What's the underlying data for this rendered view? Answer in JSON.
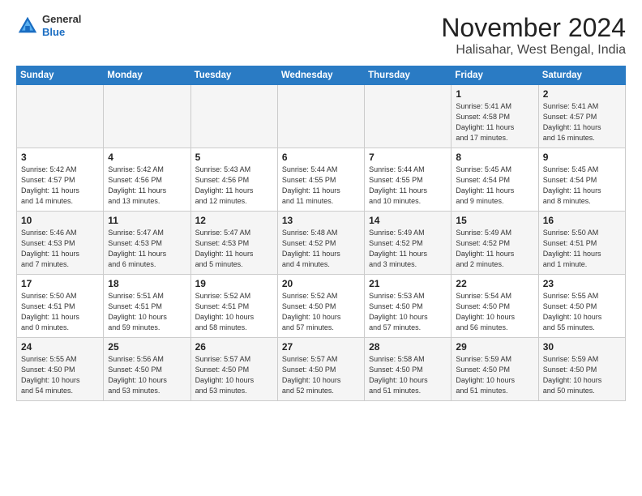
{
  "header": {
    "logo_line1": "General",
    "logo_line2": "Blue",
    "month_title": "November 2024",
    "location": "Halisahar, West Bengal, India"
  },
  "days_of_week": [
    "Sunday",
    "Monday",
    "Tuesday",
    "Wednesday",
    "Thursday",
    "Friday",
    "Saturday"
  ],
  "weeks": [
    [
      {
        "day": "",
        "info": ""
      },
      {
        "day": "",
        "info": ""
      },
      {
        "day": "",
        "info": ""
      },
      {
        "day": "",
        "info": ""
      },
      {
        "day": "",
        "info": ""
      },
      {
        "day": "1",
        "info": "Sunrise: 5:41 AM\nSunset: 4:58 PM\nDaylight: 11 hours\nand 17 minutes."
      },
      {
        "day": "2",
        "info": "Sunrise: 5:41 AM\nSunset: 4:57 PM\nDaylight: 11 hours\nand 16 minutes."
      }
    ],
    [
      {
        "day": "3",
        "info": "Sunrise: 5:42 AM\nSunset: 4:57 PM\nDaylight: 11 hours\nand 14 minutes."
      },
      {
        "day": "4",
        "info": "Sunrise: 5:42 AM\nSunset: 4:56 PM\nDaylight: 11 hours\nand 13 minutes."
      },
      {
        "day": "5",
        "info": "Sunrise: 5:43 AM\nSunset: 4:56 PM\nDaylight: 11 hours\nand 12 minutes."
      },
      {
        "day": "6",
        "info": "Sunrise: 5:44 AM\nSunset: 4:55 PM\nDaylight: 11 hours\nand 11 minutes."
      },
      {
        "day": "7",
        "info": "Sunrise: 5:44 AM\nSunset: 4:55 PM\nDaylight: 11 hours\nand 10 minutes."
      },
      {
        "day": "8",
        "info": "Sunrise: 5:45 AM\nSunset: 4:54 PM\nDaylight: 11 hours\nand 9 minutes."
      },
      {
        "day": "9",
        "info": "Sunrise: 5:45 AM\nSunset: 4:54 PM\nDaylight: 11 hours\nand 8 minutes."
      }
    ],
    [
      {
        "day": "10",
        "info": "Sunrise: 5:46 AM\nSunset: 4:53 PM\nDaylight: 11 hours\nand 7 minutes."
      },
      {
        "day": "11",
        "info": "Sunrise: 5:47 AM\nSunset: 4:53 PM\nDaylight: 11 hours\nand 6 minutes."
      },
      {
        "day": "12",
        "info": "Sunrise: 5:47 AM\nSunset: 4:53 PM\nDaylight: 11 hours\nand 5 minutes."
      },
      {
        "day": "13",
        "info": "Sunrise: 5:48 AM\nSunset: 4:52 PM\nDaylight: 11 hours\nand 4 minutes."
      },
      {
        "day": "14",
        "info": "Sunrise: 5:49 AM\nSunset: 4:52 PM\nDaylight: 11 hours\nand 3 minutes."
      },
      {
        "day": "15",
        "info": "Sunrise: 5:49 AM\nSunset: 4:52 PM\nDaylight: 11 hours\nand 2 minutes."
      },
      {
        "day": "16",
        "info": "Sunrise: 5:50 AM\nSunset: 4:51 PM\nDaylight: 11 hours\nand 1 minute."
      }
    ],
    [
      {
        "day": "17",
        "info": "Sunrise: 5:50 AM\nSunset: 4:51 PM\nDaylight: 11 hours\nand 0 minutes."
      },
      {
        "day": "18",
        "info": "Sunrise: 5:51 AM\nSunset: 4:51 PM\nDaylight: 10 hours\nand 59 minutes."
      },
      {
        "day": "19",
        "info": "Sunrise: 5:52 AM\nSunset: 4:51 PM\nDaylight: 10 hours\nand 58 minutes."
      },
      {
        "day": "20",
        "info": "Sunrise: 5:52 AM\nSunset: 4:50 PM\nDaylight: 10 hours\nand 57 minutes."
      },
      {
        "day": "21",
        "info": "Sunrise: 5:53 AM\nSunset: 4:50 PM\nDaylight: 10 hours\nand 57 minutes."
      },
      {
        "day": "22",
        "info": "Sunrise: 5:54 AM\nSunset: 4:50 PM\nDaylight: 10 hours\nand 56 minutes."
      },
      {
        "day": "23",
        "info": "Sunrise: 5:55 AM\nSunset: 4:50 PM\nDaylight: 10 hours\nand 55 minutes."
      }
    ],
    [
      {
        "day": "24",
        "info": "Sunrise: 5:55 AM\nSunset: 4:50 PM\nDaylight: 10 hours\nand 54 minutes."
      },
      {
        "day": "25",
        "info": "Sunrise: 5:56 AM\nSunset: 4:50 PM\nDaylight: 10 hours\nand 53 minutes."
      },
      {
        "day": "26",
        "info": "Sunrise: 5:57 AM\nSunset: 4:50 PM\nDaylight: 10 hours\nand 53 minutes."
      },
      {
        "day": "27",
        "info": "Sunrise: 5:57 AM\nSunset: 4:50 PM\nDaylight: 10 hours\nand 52 minutes."
      },
      {
        "day": "28",
        "info": "Sunrise: 5:58 AM\nSunset: 4:50 PM\nDaylight: 10 hours\nand 51 minutes."
      },
      {
        "day": "29",
        "info": "Sunrise: 5:59 AM\nSunset: 4:50 PM\nDaylight: 10 hours\nand 51 minutes."
      },
      {
        "day": "30",
        "info": "Sunrise: 5:59 AM\nSunset: 4:50 PM\nDaylight: 10 hours\nand 50 minutes."
      }
    ]
  ]
}
